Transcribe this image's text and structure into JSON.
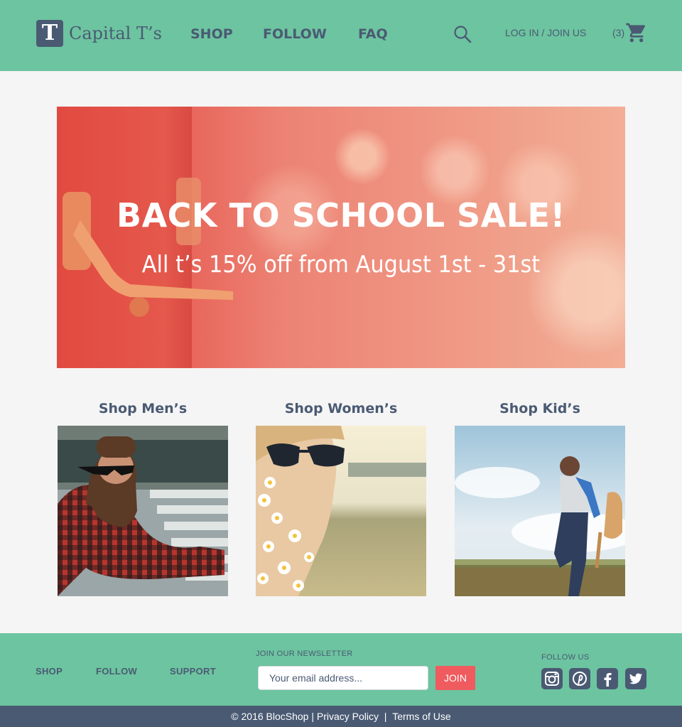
{
  "header": {
    "logo_letter": "T",
    "brand": "Capital T’s",
    "nav": [
      "SHOP",
      "FOLLOW",
      "FAQ"
    ],
    "search_icon": "search-icon",
    "login": "LOG IN / JOIN US",
    "cart_count": "(3)",
    "cart_icon": "shopping-cart-icon"
  },
  "hero": {
    "title": "BACK TO SCHOOL SALE!",
    "subtitle": "All t’s 15% off from August 1st - 31st"
  },
  "categories": [
    {
      "title": "Shop Men’s"
    },
    {
      "title": "Shop Women’s"
    },
    {
      "title": "Shop Kid’s"
    }
  ],
  "footer": {
    "links": [
      "SHOP",
      "FOLLOW",
      "SUPPORT"
    ],
    "newsletter_label": "JOIN OUR NEWSLETTER",
    "email_placeholder": "Your email address...",
    "join_label": "JOIN",
    "follow_label": "FOLLOW US",
    "social_icons": [
      "instagram-icon",
      "pinterest-icon",
      "facebook-icon",
      "twitter-icon"
    ]
  },
  "bottom": {
    "copyright": "© 2016 BlocShop",
    "privacy": "Privacy Policy",
    "terms": "Terms of Use"
  },
  "colors": {
    "header_bg": "#6dc4a0",
    "text_dark": "#4a5a73",
    "accent_red": "#ef5b5e",
    "bottom_bar": "#4a5a73",
    "page_bg": "#f5f5f5"
  }
}
